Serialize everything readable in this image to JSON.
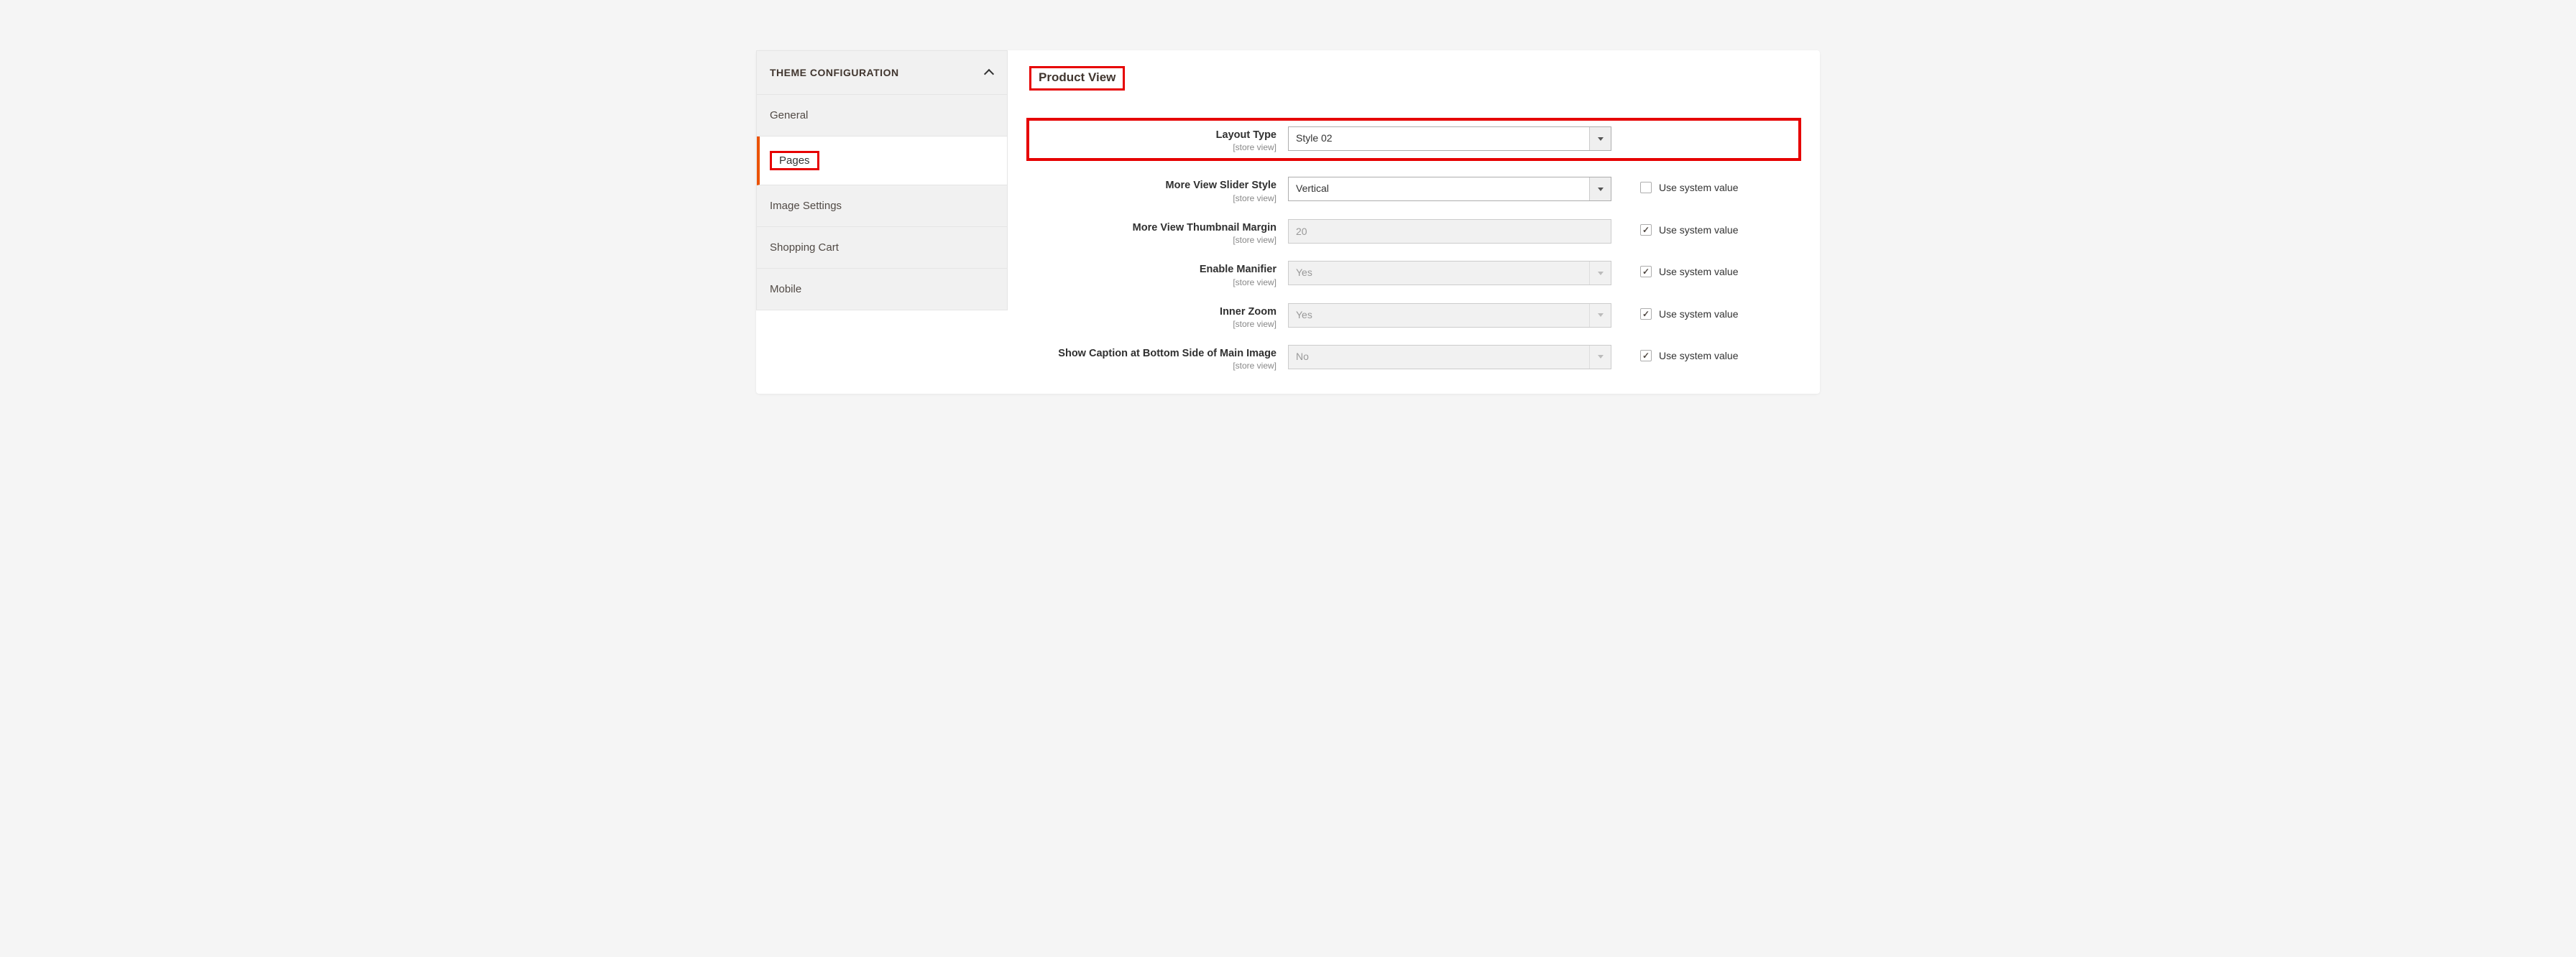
{
  "sidebar": {
    "title": "THEME CONFIGURATION",
    "items": [
      {
        "label": "General"
      },
      {
        "label": "Pages"
      },
      {
        "label": "Image Settings"
      },
      {
        "label": "Shopping Cart"
      },
      {
        "label": "Mobile"
      }
    ]
  },
  "section_title": "Product View",
  "scope_label": "[store view]",
  "use_system_value": "Use system value",
  "fields": {
    "layout_type": {
      "label": "Layout Type",
      "value": "Style 02"
    },
    "slider_style": {
      "label": "More View Slider Style",
      "value": "Vertical"
    },
    "thumb_margin": {
      "label": "More View Thumbnail Margin",
      "value": "20"
    },
    "enable_magnifier": {
      "label": "Enable Manifier",
      "value": "Yes"
    },
    "inner_zoom": {
      "label": "Inner Zoom",
      "value": "Yes"
    },
    "show_caption": {
      "label": "Show Caption at Bottom Side of Main Image",
      "value": "No"
    }
  }
}
